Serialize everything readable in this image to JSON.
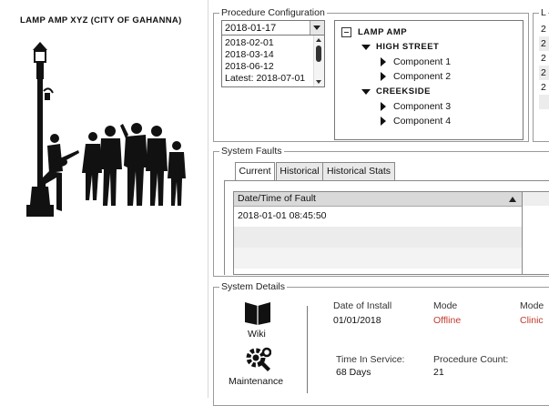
{
  "app": {
    "title": "LAMP AMP XYZ (CITY OF GAHANNA)"
  },
  "procedure_config": {
    "legend": "Procedure Configuration",
    "selected_date": "2018-01-17",
    "date_list": [
      "2018-02-01",
      "2018-03-14",
      "2018-06-12",
      "Latest: 2018-07-01"
    ],
    "tree": {
      "root": "LAMP AMP",
      "groups": [
        {
          "name": "HIGH STREET",
          "children": [
            "Component 1",
            "Component 2"
          ]
        },
        {
          "name": "CREEKSIDE",
          "children": [
            "Component 3",
            "Component 4"
          ]
        }
      ]
    }
  },
  "right_partial": {
    "legend": "L",
    "rows": [
      "2",
      "2",
      "2",
      "2",
      "2"
    ]
  },
  "system_faults": {
    "legend": "System Faults",
    "tabs": [
      "Current",
      "Historical",
      "Historical Stats"
    ],
    "active_tab": "Current",
    "column_header": "Date/Time of Fault",
    "rows": [
      "2018-01-01 08:45:50"
    ]
  },
  "system_details": {
    "legend": "System Details",
    "wiki_label": "Wiki",
    "maintenance_label": "Maintenance",
    "date_of_install_label": "Date of Install",
    "date_of_install_value": "01/01/2018",
    "mode_label": "Mode",
    "mode_value": "Offline",
    "mode2_label": "Mode",
    "mode2_value": "Clinic",
    "time_in_service_label": "Time In Service:",
    "time_in_service_value": "68 Days",
    "procedure_count_label": "Procedure Count:",
    "procedure_count_value": "21",
    "status_color": "#c0392b"
  }
}
